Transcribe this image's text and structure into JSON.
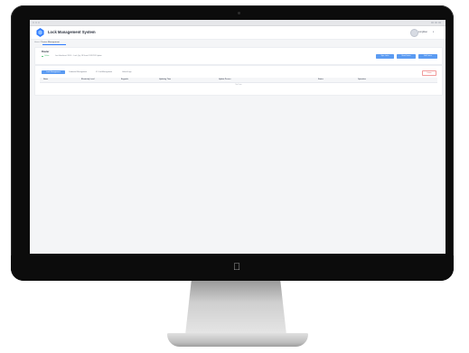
{
  "app": {
    "title": "Lock Management System",
    "user_name": "Longbiao",
    "brand_color": "#2f7bff"
  },
  "breadcrumb": {
    "home": "Home",
    "current": "Device Management"
  },
  "device_card": {
    "title": "Router",
    "status": "Online",
    "info": "Last Heartbeat: 2024-... Lock Qty: 18 Serial: XXXXXX  Update",
    "buttons": [
      "Sync Locks",
      "Reset Device",
      "Edit Device"
    ]
  },
  "tabs": [
    "Lock Management",
    "Credential Management",
    "IC Card Management",
    "Unlock Logs"
  ],
  "tab_right_button": "Delete",
  "table": {
    "columns": [
      "Name",
      "Electricity Level",
      "Keypads",
      "Updating Time",
      "Update Person",
      "Status",
      "Operation"
    ],
    "empty_text": "No Data"
  }
}
